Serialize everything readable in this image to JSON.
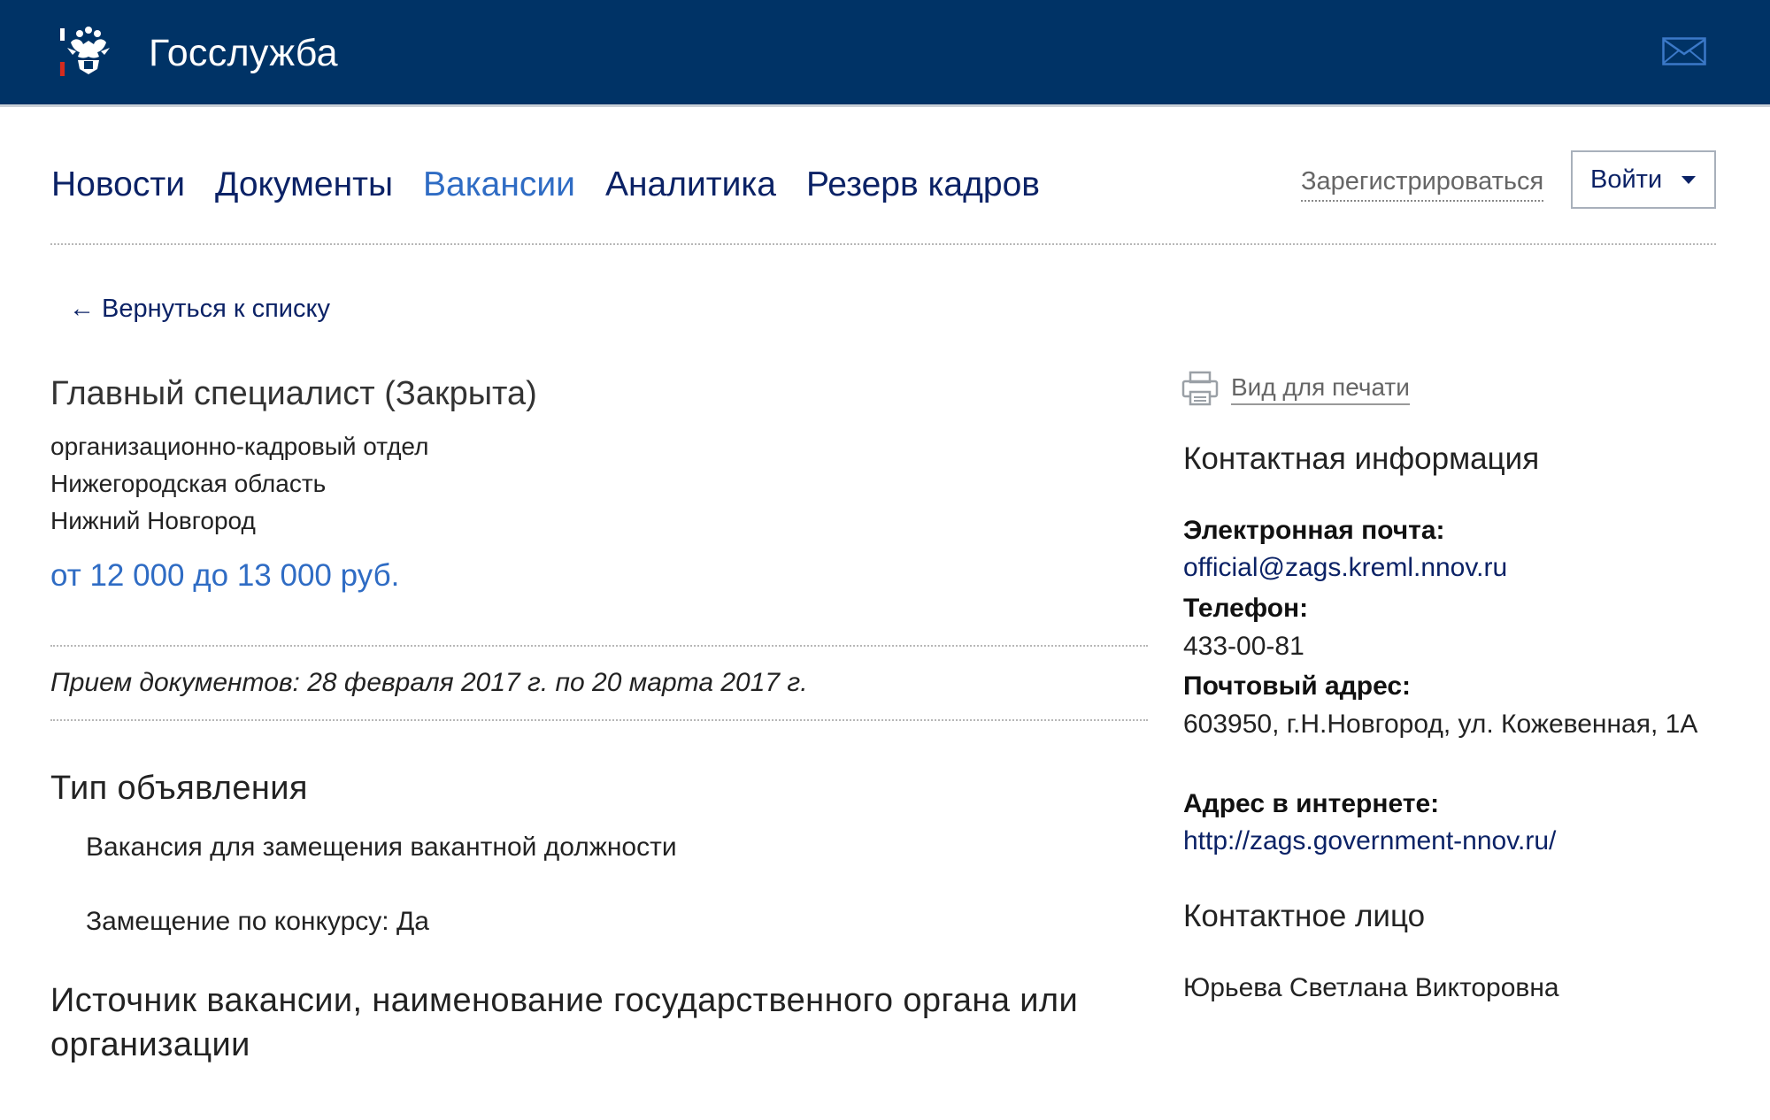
{
  "header": {
    "brand": "Госслужба",
    "logo_icon": "russian-coat-of-arms-icon",
    "mail_icon": "envelope-icon",
    "background_color": "#003366"
  },
  "nav": {
    "items": [
      {
        "label": "Новости",
        "active": false
      },
      {
        "label": "Документы",
        "active": false
      },
      {
        "label": "Вакансии",
        "active": true
      },
      {
        "label": "Аналитика",
        "active": false
      },
      {
        "label": "Резерв кадров",
        "active": false
      }
    ],
    "active_color": "#2f6cc4",
    "register_label": "Зарегистрироваться",
    "login_label": "Войти"
  },
  "back_link": "← Вернуться к списку",
  "vacancy": {
    "title": "Главный специалист (Закрыта)",
    "department": "организационно-кадровый отдел",
    "region": "Нижегородская область",
    "city": "Нижний Новгород",
    "salary": "от 12 000 до 13 000 руб.",
    "documents_period": "Прием документов: 28 февраля 2017 г. по 20 марта 2017 г."
  },
  "sections": {
    "announcement_type_heading": "Тип объявления",
    "announcement_type_value": "Вакансия для замещения вакантной должности",
    "competition": "Замещение по конкурсу: Да",
    "source_heading": "Источник вакансии, наименование государственного органа или организации"
  },
  "sidebar": {
    "print_label": "Вид для печати",
    "print_icon": "printer-icon",
    "contact_heading": "Контактная информация",
    "email_label": "Электронная почта:",
    "email_value": "official@zags.kreml.nnov.ru",
    "phone_label": "Телефон:",
    "phone_value": "433-00-81",
    "address_label": "Почтовый адрес:",
    "address_value": "603950, г.Н.Новгород, ул. Кожевенная, 1А",
    "website_label": "Адрес в интернете:",
    "website_value": "http://zags.government-nnov.ru/",
    "contact_person_heading": "Контактное лицо",
    "contact_person_name": "Юрьева Светлана Викторовна"
  }
}
